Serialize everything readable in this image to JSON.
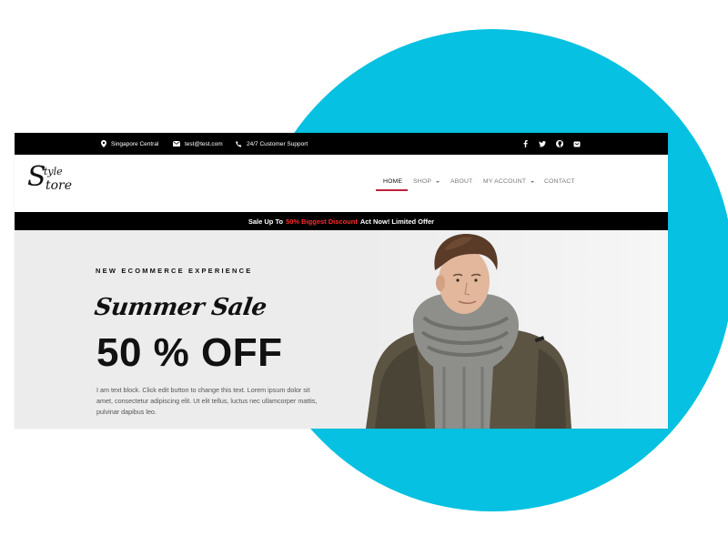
{
  "topbar": {
    "location": "Singapore Central",
    "email": "test@test.com",
    "support": "24/7 Customer Support",
    "social": [
      "facebook-icon",
      "twitter-icon",
      "github-icon",
      "bag-icon"
    ]
  },
  "logo": {
    "text1": "tyle",
    "text2": "tore",
    "initial": "S"
  },
  "nav": {
    "home": "HOME",
    "shop": "SHOP",
    "about": "ABOUT",
    "account": "MY ACCOUNT",
    "contact": "CONTACT"
  },
  "promo": {
    "prefix": "Sale Up To",
    "highlight": "50% Biggest Discount",
    "suffix": "Act Now! Limited Offer",
    "highlight_color": "#ff2a2a"
  },
  "hero": {
    "eyebrow": "NEW ECOMMERCE EXPERIENCE",
    "script_title": "Summer Sale",
    "headline": "50 % OFF",
    "body": "I am text block. Click edit button to change this text. Lorem ipsum dolor sit amet, consectetur adipiscing elit. Ut elit tellus, luctus nec ullamcorper mattis, pulvinar dapibus leo."
  },
  "colors": {
    "accent_circle": "#06c1e1",
    "active_underline": "#c0223a"
  }
}
